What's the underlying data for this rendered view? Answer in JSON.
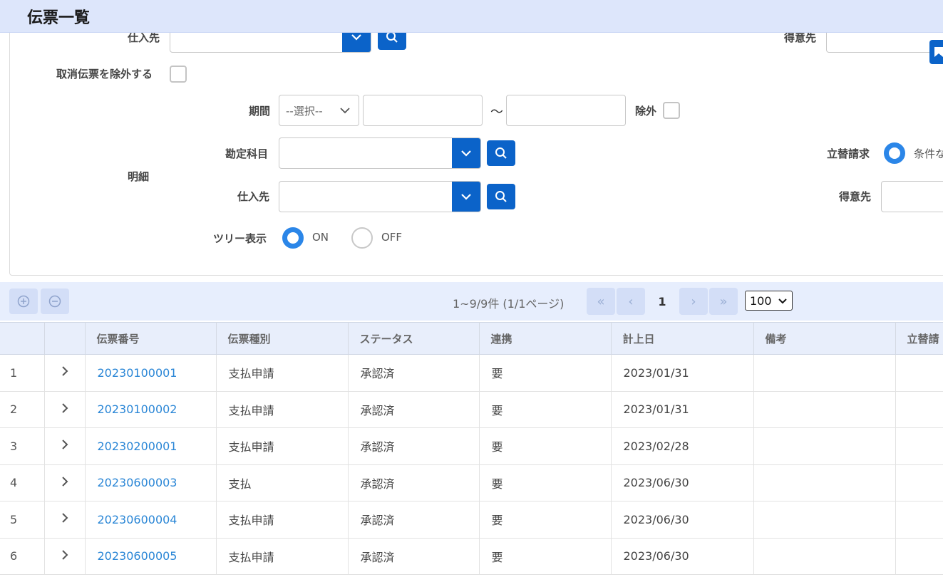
{
  "header": {
    "title": "伝票一覧"
  },
  "filters": {
    "supplier_label_top": "仕入先",
    "customer_label_top": "得意先",
    "exclude_cancelled_label": "取消伝票を除外する",
    "period_label": "期間",
    "period_select_value": "--選択--",
    "tilde": "～",
    "exclude_label": "除外",
    "detail_label": "明細",
    "account_label": "勘定科目",
    "supplier_label": "仕入先",
    "advance_label": "立替請求",
    "advance_option": "条件な",
    "customer_label": "得意先",
    "tree_label": "ツリー表示",
    "tree_on": "ON",
    "tree_off": "OFF"
  },
  "toolbar": {
    "summary": "1~9/9件 (1/1ページ)",
    "current_page": "1",
    "page_size": "100"
  },
  "table": {
    "headers": [
      "",
      "",
      "伝票番号",
      "伝票種別",
      "ステータス",
      "連携",
      "計上日",
      "備考",
      "立替請"
    ],
    "rows": [
      {
        "no": "1",
        "id": "20230100001",
        "type": "支払申請",
        "status": "承認済",
        "link": "要",
        "date": "2023/01/31",
        "note": ""
      },
      {
        "no": "2",
        "id": "20230100002",
        "type": "支払申請",
        "status": "承認済",
        "link": "要",
        "date": "2023/01/31",
        "note": ""
      },
      {
        "no": "3",
        "id": "20230200001",
        "type": "支払申請",
        "status": "承認済",
        "link": "要",
        "date": "2023/02/28",
        "note": ""
      },
      {
        "no": "4",
        "id": "20230600003",
        "type": "支払",
        "status": "承認済",
        "link": "要",
        "date": "2023/06/30",
        "note": ""
      },
      {
        "no": "5",
        "id": "20230600004",
        "type": "支払申請",
        "status": "承認済",
        "link": "要",
        "date": "2023/06/30",
        "note": ""
      },
      {
        "no": "6",
        "id": "20230600005",
        "type": "支払申請",
        "status": "承認済",
        "link": "要",
        "date": "2023/06/30",
        "note": ""
      }
    ]
  },
  "colors": {
    "primary": "#0b63c9",
    "header_bg": "#dde6fb",
    "link": "#2a86d6",
    "radio_on": "#2b86e8"
  }
}
